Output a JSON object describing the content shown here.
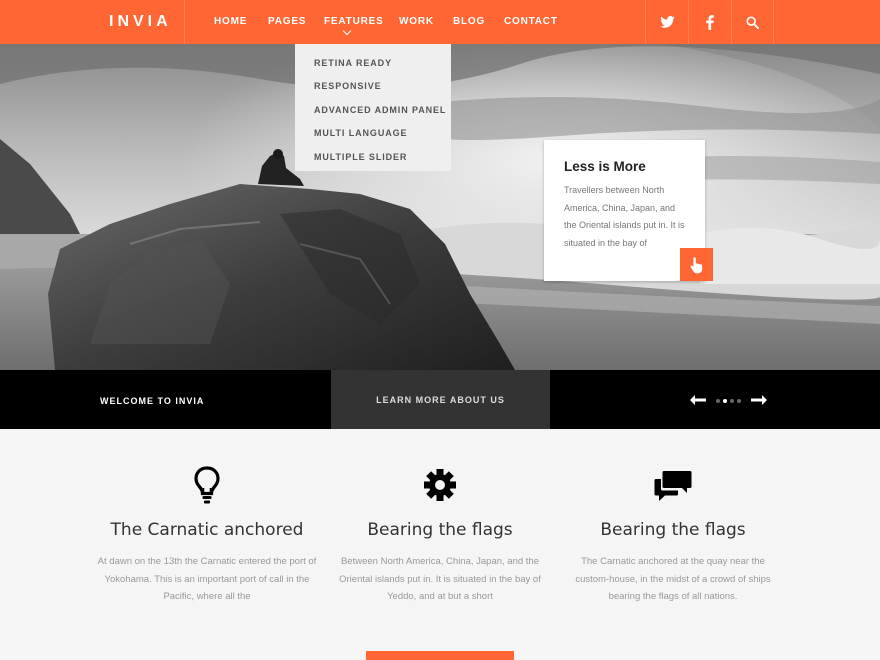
{
  "brand": {
    "logo": "INVIA",
    "accent": "#ff6633"
  },
  "nav": {
    "items": [
      {
        "label": "HOME"
      },
      {
        "label": "PAGES"
      },
      {
        "label": "FEATURES"
      },
      {
        "label": "WORK"
      },
      {
        "label": "BLOG"
      },
      {
        "label": "CONTACT"
      }
    ],
    "social": [
      "twitter-icon",
      "facebook-icon",
      "search-icon"
    ]
  },
  "dropdown": {
    "items": [
      "RETINA READY",
      "RESPONSIVE",
      "ADVANCED ADMIN PANEL",
      "MULTI LANGUAGE",
      "MULTIPLE SLIDER"
    ]
  },
  "info_card": {
    "title": "Less is More",
    "text": "Travellers between North America, China, Japan, and the Oriental islands put in. It is situated in the bay of",
    "button_icon": "hand-pointer-icon"
  },
  "strip": {
    "welcome": "WELCOME TO INVIA",
    "learn_more": "LEARN MORE ABOUT US",
    "slides_total": 4,
    "slides_active": 2
  },
  "features": [
    {
      "icon": "lightbulb-icon",
      "title": "The Carnatic anchored",
      "text": "At dawn on the 13th the Carnatic entered the port of Yokohama.  This is an important port of call in the Pacific, where all the"
    },
    {
      "icon": "gear-icon",
      "title": "Bearing the flags",
      "text": "Between North America, China, Japan, and the Oriental islands put in.  It is situated in the bay of Yeddo, and at but a short"
    },
    {
      "icon": "chat-bubbles-icon",
      "title": "Bearing the flags",
      "text": "The Carnatic anchored at the quay near the custom-house, in the midst of a crowd of ships bearing the flags of all nations."
    }
  ]
}
